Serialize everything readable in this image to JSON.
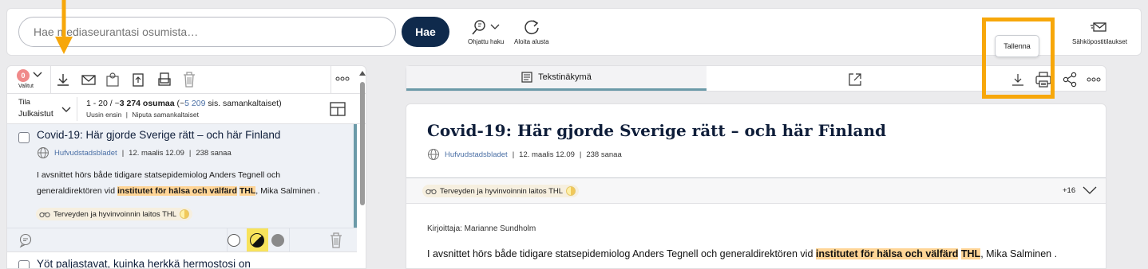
{
  "search": {
    "placeholder": "Hae mediaseurantasi osumista…",
    "button_label": "Hae"
  },
  "top_tools": {
    "advanced_search": "Ohjattu haku",
    "restart": "Aloita alusta",
    "email_alerts": "Sähköpostitilaukset"
  },
  "left": {
    "selected_count": "0",
    "selected_label": "Valitut",
    "state_label": "Tila",
    "state_value": "Julkaistut",
    "result_range": "1 - 20 / ~",
    "result_count": "3 274 osumaa",
    "similar_open": " (~",
    "similar_count": "5 209",
    "similar_close": " sis. samankaltaiset)",
    "sort_newest": "Uusin ensin",
    "group_similar": "Niputa samankaltaiset",
    "item1": {
      "title": "Covid-19: Här gjorde Sverige rätt – och här Finland",
      "source": "Hufvudstadsbladet",
      "sep1": "|",
      "date": "12. maalis 12.09",
      "sep2": "|",
      "words": "238 sanaa",
      "snippet_1": "I avsnittet hörs både tidigare statsepidemiolog Anders Tegnell och",
      "snippet_2a": "generaldirektören vid ",
      "snippet_hl1": "institutet för hälsa och välfärd",
      "snippet_sp": " ",
      "snippet_hl2": "THL",
      "snippet_2b": ", Mika Salminen .",
      "tag": "Terveyden ja hyvinvoinnin laitos THL"
    },
    "item2": {
      "title": "Yöt paljastavat, kuinka herkkä hermostosi on"
    }
  },
  "right": {
    "tab_text_view": "Tekstinäkymä",
    "tooltip_save": "Tallenna",
    "title": "Covid-19: Här gjorde Sverige rätt – och här Finland",
    "source": "Hufvudstadsbladet",
    "sep1": "|",
    "date": "12. maalis 12.09",
    "sep2": "|",
    "words": "238 sanaa",
    "tag": "Terveyden ja hyvinvoinnin laitos THL",
    "more_tags": "+16",
    "author": "Kirjoittaja: Marianne Sundholm",
    "body_a": "I avsnittet hörs både tidigare statsepidemiolog Anders Tegnell och generaldirektören vid ",
    "body_hl1": "institutet för hälsa och välfärd",
    "body_sp": " ",
    "body_hl2": "THL",
    "body_b": ", Mika Salminen ."
  },
  "colors": {
    "navy": "#0f2a4c",
    "accent": "#6b9aa8",
    "highlight": "#ffd596",
    "annotation": "#f7a70a",
    "badge": "#f08a8a"
  },
  "icons": [
    "search-advanced-icon",
    "chevron-down-icon",
    "restart-icon",
    "email-alert-icon",
    "download-icon",
    "mail-icon",
    "share-icon",
    "export-icon",
    "copy-icon",
    "delete-icon",
    "more-icon",
    "layout-icon",
    "globe-icon",
    "binoculars-icon",
    "comment-icon",
    "external-link-icon",
    "print-icon",
    "text-view-icon"
  ]
}
